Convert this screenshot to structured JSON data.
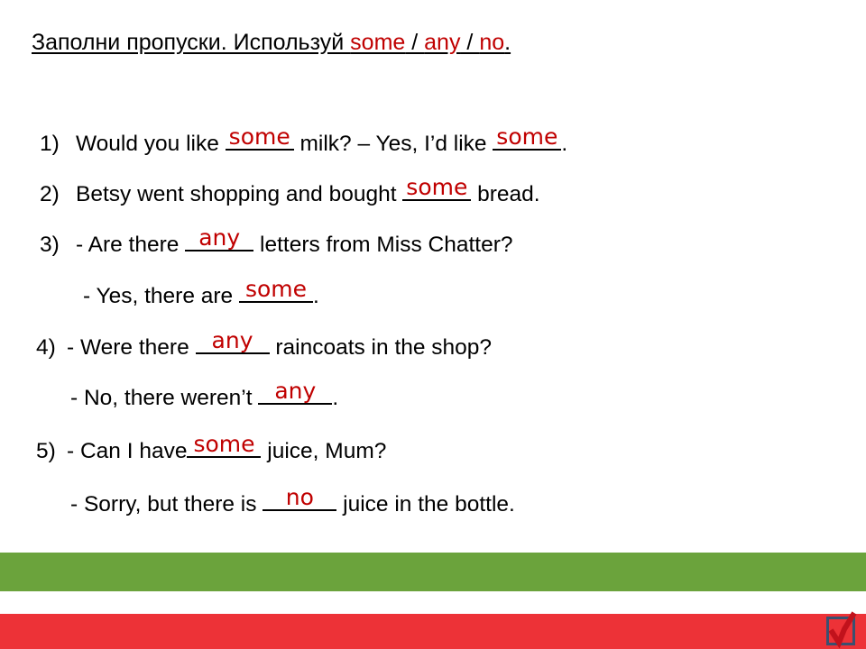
{
  "title": {
    "lead": "Заполни пропуски. Используй ",
    "kw1": "some",
    "sep1": " / ",
    "kw2": "any",
    "sep2": " / ",
    "kw3": "no",
    "period": "."
  },
  "exercise": [
    {
      "number": "1)",
      "before": "Would you like",
      "answer": "some",
      "middle": "milk? – Yes, I’d like",
      "answer2": "some",
      "after": "."
    },
    {
      "number": "2)",
      "before": "Betsy went shopping and bought",
      "answer": "some",
      "after": "bread."
    },
    {
      "number": "3)",
      "before": "- Are there",
      "answer": "any",
      "after": "letters from Miss Chatter?"
    },
    {
      "number": "",
      "before": "- Yes, there are",
      "answer": "some",
      "after": "."
    },
    {
      "number": "4)",
      "before": "- Were there",
      "answer": "any",
      "after": "raincoats in the shop?"
    },
    {
      "number": "",
      "before": "- No, there weren’t",
      "answer": "any",
      "after": "."
    },
    {
      "number": "5)",
      "before": "- Can I have",
      "answer": "some",
      "after": "juice, Mum?"
    },
    {
      "number": "",
      "before": "- Sorry, but there is",
      "answer": "no",
      "after": "juice in the bottle."
    }
  ],
  "decoration": {
    "green_bar_color": "#6BA33C",
    "red_bar_color": "#ED3237",
    "answer_color": "#C00000",
    "checkbox_border_color": "#3A5070",
    "checkmark_color": "#C1121C",
    "checkbox_label": "checked"
  }
}
